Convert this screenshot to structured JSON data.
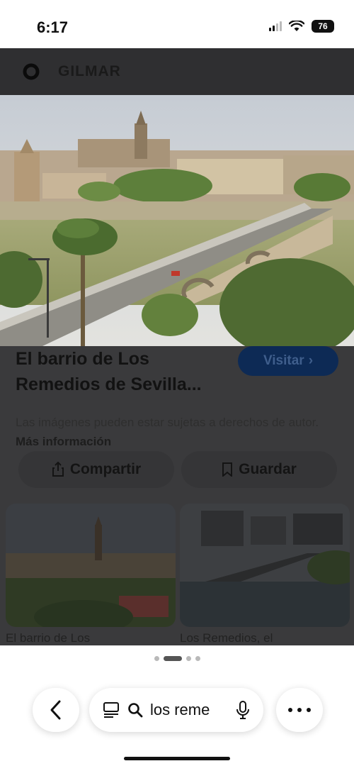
{
  "status": {
    "time": "6:17",
    "battery": "76"
  },
  "app": {
    "name": "GILMAR"
  },
  "result": {
    "title": "El barrio de Los Remedios de Sevilla...",
    "visit_label": "Visitar",
    "disclaimer_text": "Las imágenes pueden estar sujetas a derechos de autor. ",
    "disclaimer_link": "Más información",
    "share_label": "Compartir",
    "save_label": "Guardar"
  },
  "related": [
    {
      "label": "El barrio de Los"
    },
    {
      "label": "Los Remedios, el"
    }
  ],
  "toolbar": {
    "url_text": "los reme"
  },
  "colors": {
    "overlay": "#3a3a3c",
    "visit_button": "#0d2a55"
  }
}
